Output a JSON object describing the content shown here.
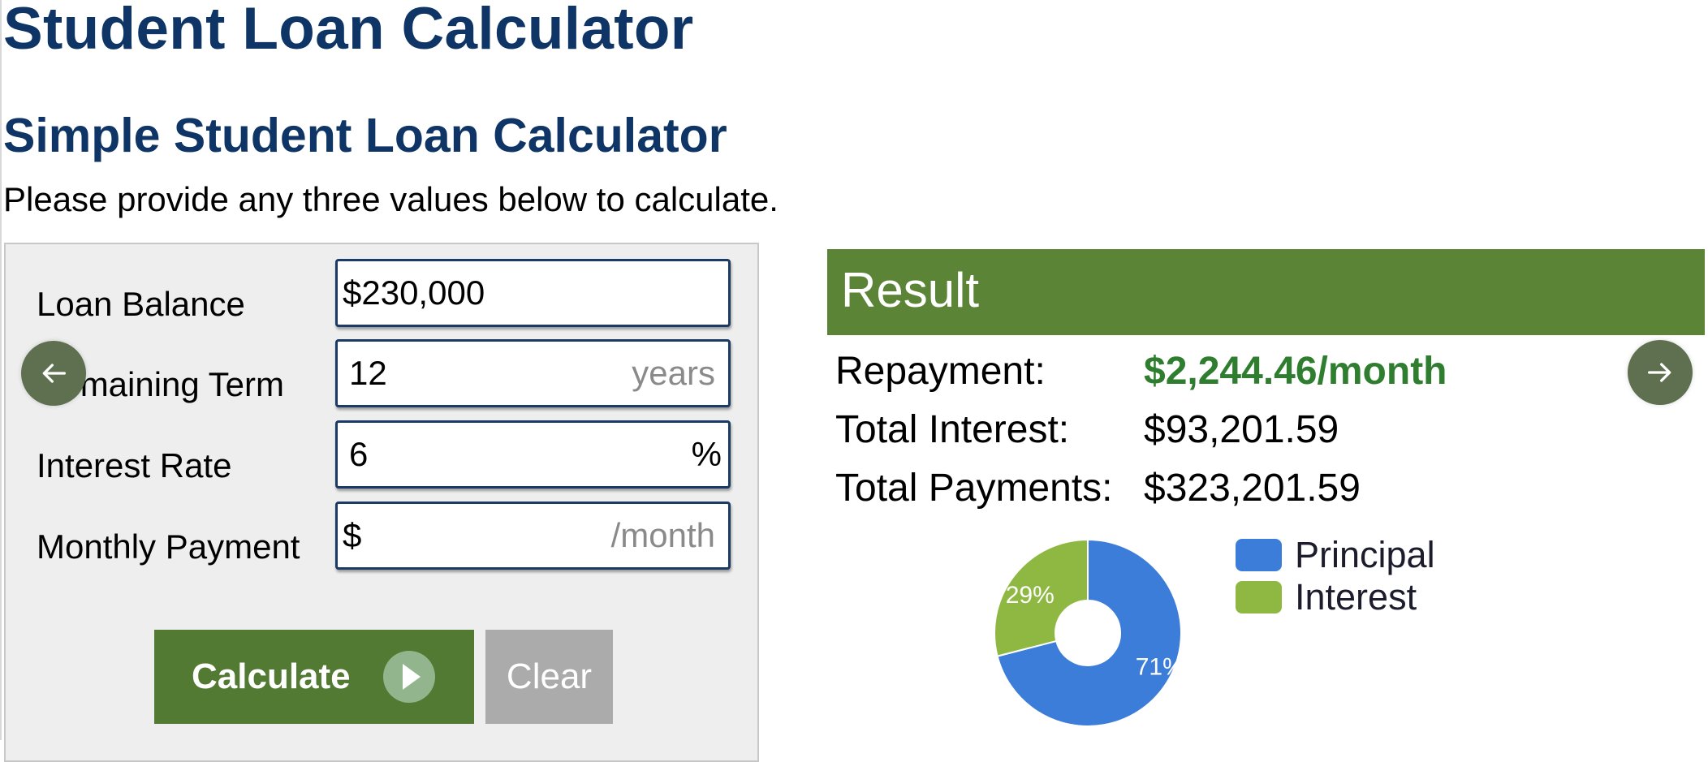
{
  "page": {
    "title": "Student Loan Calculator",
    "subtitle": "Simple Student Loan Calculator",
    "instruction": "Please provide any three values below to calculate."
  },
  "form": {
    "fields": [
      {
        "label": "Loan Balance",
        "value": "$230,000",
        "unit": ""
      },
      {
        "label": "Remaining Term",
        "value": "12",
        "unit": "years"
      },
      {
        "label": "Interest Rate",
        "value": "6",
        "unit": "%"
      },
      {
        "label": "Monthly Payment",
        "prefix": "$",
        "value": "",
        "unit": "/month"
      }
    ],
    "calculate_label": "Calculate",
    "clear_label": "Clear"
  },
  "result": {
    "header": "Result",
    "rows": [
      {
        "label": "Repayment:",
        "value": "$2,244.46/month"
      },
      {
        "label": "Total Interest:",
        "value": "$93,201.59"
      },
      {
        "label": "Total Payments:",
        "value": "$323,201.59"
      }
    ]
  },
  "navigation": {
    "prev_icon": "arrow-left-icon",
    "next_icon": "arrow-right-icon"
  },
  "colors": {
    "heading": "#0e3566",
    "accent_green": "#5b8437",
    "highlight_green": "#2f7d2f",
    "principal": "#3b7dd8",
    "interest": "#8fb843",
    "clear_button": "#ababab"
  },
  "chart_data": {
    "type": "pie",
    "donut": true,
    "title": "",
    "legend_position": "right",
    "categories": [
      "Principal",
      "Interest"
    ],
    "values": [
      71,
      29
    ],
    "labels": [
      "71%",
      "29%"
    ],
    "colors": [
      "#3b7dd8",
      "#8fb843"
    ]
  }
}
